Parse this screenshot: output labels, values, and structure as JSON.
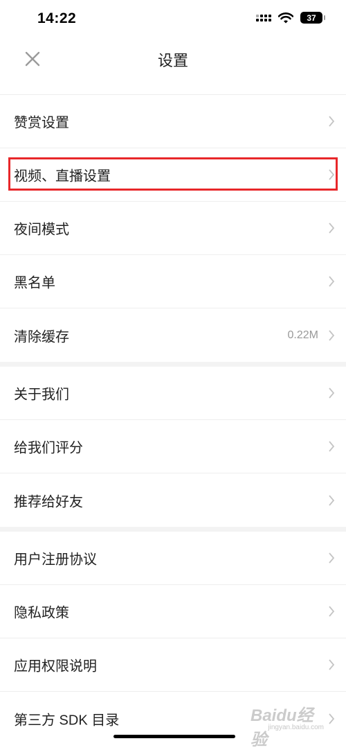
{
  "status_bar": {
    "time": "14:22",
    "battery": "37"
  },
  "nav": {
    "title": "设置",
    "close_icon": "close-icon"
  },
  "settings": {
    "group1": [
      {
        "label": "赞赏设置",
        "value": ""
      },
      {
        "label": "视频、直播设置",
        "value": ""
      },
      {
        "label": "夜间模式",
        "value": ""
      },
      {
        "label": "黑名单",
        "value": ""
      },
      {
        "label": "清除缓存",
        "value": "0.22M"
      }
    ],
    "group2": [
      {
        "label": "关于我们",
        "value": ""
      },
      {
        "label": "给我们评分",
        "value": ""
      },
      {
        "label": "推荐给好友",
        "value": ""
      }
    ],
    "group3": [
      {
        "label": "用户注册协议",
        "value": ""
      },
      {
        "label": "隐私政策",
        "value": ""
      },
      {
        "label": "应用权限说明",
        "value": ""
      },
      {
        "label": "第三方 SDK 目录",
        "value": ""
      }
    ]
  },
  "watermark": {
    "brand": "Baidu经验",
    "url": "jingyan.baidu.com"
  },
  "colors": {
    "highlight": "#e8272a",
    "separator": "#f3f3f3",
    "chevron": "#c4c4c4"
  }
}
